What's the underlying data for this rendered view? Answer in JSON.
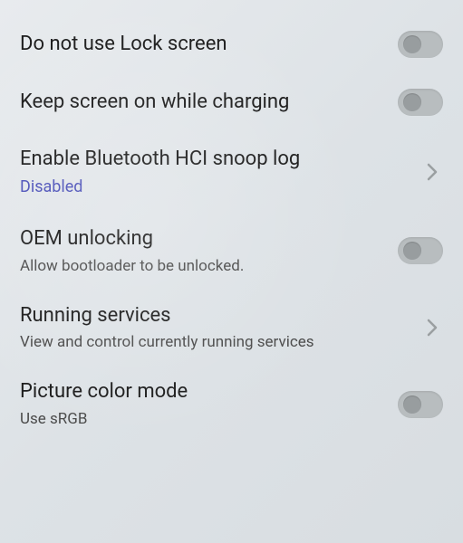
{
  "settings": {
    "lock_screen": {
      "title": "Do not use Lock screen"
    },
    "keep_screen": {
      "title": "Keep screen on while charging"
    },
    "bluetooth_hci": {
      "title": "Enable Bluetooth HCI snoop log",
      "subtitle": "Disabled"
    },
    "oem_unlocking": {
      "title": "OEM unlocking",
      "subtitle": "Allow bootloader to be unlocked."
    },
    "running_services": {
      "title": "Running services",
      "subtitle": "View and control currently running services"
    },
    "picture_color": {
      "title": "Picture color mode",
      "subtitle": "Use sRGB"
    }
  }
}
